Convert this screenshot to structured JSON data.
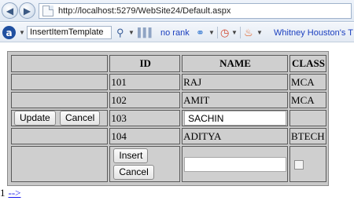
{
  "browser": {
    "address": "http://localhost:5279/WebSite24/Default.aspx"
  },
  "toolbar": {
    "search_value": "InsertItemTemplate",
    "rank_label": "no rank",
    "link_label": "Whitney Houston's T"
  },
  "grid": {
    "headers": [
      "",
      "ID",
      "NAME",
      "CLASS"
    ],
    "rows": [
      {
        "id": "101",
        "name": "RAJ",
        "class": "MCA"
      },
      {
        "id": "102",
        "name": "AMIT",
        "class": "MCA"
      },
      {
        "id": "103",
        "name": "SACHIN",
        "class": ""
      },
      {
        "id": "104",
        "name": "ADITYA",
        "class": "BTECH"
      }
    ],
    "edit_row": {
      "update_label": "Update",
      "cancel_label": "Cancel",
      "name_value": "SACHIN"
    },
    "insert_row": {
      "insert_label": "Insert",
      "cancel_label": "Cancel",
      "name_value": ""
    }
  },
  "pager": {
    "page_number": "1",
    "next_label": "-->"
  }
}
